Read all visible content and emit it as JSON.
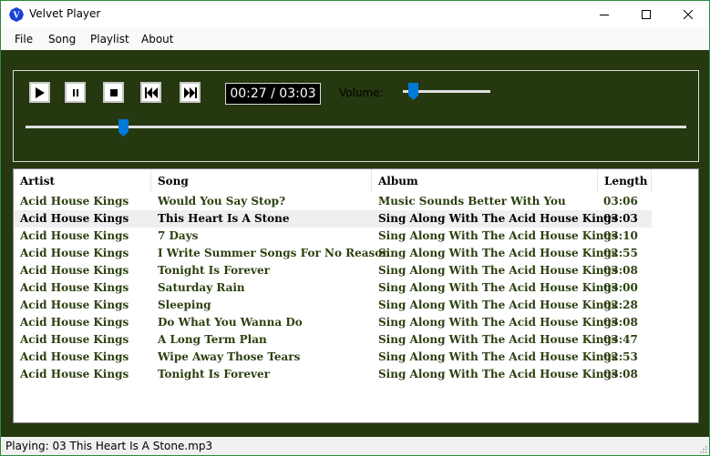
{
  "window": {
    "title": "Velvet Player",
    "icon": "velvet-logo-icon",
    "controls": [
      "minimize-icon",
      "maximize-icon",
      "close-icon"
    ]
  },
  "menu": {
    "items": [
      {
        "label": "File"
      },
      {
        "label": "Song"
      },
      {
        "label": "Playlist"
      },
      {
        "label": "About"
      }
    ]
  },
  "player": {
    "buttons": [
      {
        "name": "play",
        "icon": "play-icon"
      },
      {
        "name": "pause",
        "icon": "pause-icon"
      },
      {
        "name": "stop",
        "icon": "stop-icon"
      },
      {
        "name": "previous",
        "icon": "skip-back-icon"
      },
      {
        "name": "next",
        "icon": "skip-forward-icon"
      }
    ],
    "time_display": "00:27 / 03:03",
    "volume_label": "Volume:",
    "volume_level": 0.12,
    "seek_position": 0.148,
    "accent_color": "#0078d7"
  },
  "playlist": {
    "columns": [
      "Artist",
      "Song",
      "Album",
      "Length"
    ],
    "selected_index": 1,
    "rows": [
      {
        "artist": "Acid House Kings",
        "song": "Would You Say Stop?",
        "album": "Music Sounds Better With You",
        "length": "03:06"
      },
      {
        "artist": "Acid House Kings",
        "song": "This Heart Is A Stone",
        "album": "Sing Along With The Acid House Kings",
        "length": "03:03"
      },
      {
        "artist": "Acid House Kings",
        "song": "7 Days",
        "album": "Sing Along With The Acid House Kings",
        "length": "03:10"
      },
      {
        "artist": "Acid House Kings",
        "song": "I Write Summer Songs For No Reason",
        "album": "Sing Along With The Acid House Kings",
        "length": "02:55"
      },
      {
        "artist": "Acid House Kings",
        "song": "Tonight Is Forever",
        "album": "Sing Along With The Acid House Kings",
        "length": "03:08"
      },
      {
        "artist": "Acid House Kings",
        "song": "Saturday Rain",
        "album": "Sing Along With The Acid House Kings",
        "length": "03:00"
      },
      {
        "artist": "Acid House Kings",
        "song": "Sleeping",
        "album": "Sing Along With The Acid House Kings",
        "length": "02:28"
      },
      {
        "artist": "Acid House Kings",
        "song": "Do What You Wanna Do",
        "album": "Sing Along With The Acid House Kings",
        "length": "03:08"
      },
      {
        "artist": "Acid House Kings",
        "song": "A Long Term Plan",
        "album": "Sing Along With The Acid House Kings",
        "length": "03:47"
      },
      {
        "artist": "Acid House Kings",
        "song": "Wipe Away Those Tears",
        "album": "Sing Along With The Acid House Kings",
        "length": "02:53"
      },
      {
        "artist": "Acid House Kings",
        "song": "Tonight Is Forever",
        "album": "Sing Along With The Acid House Kings",
        "length": "03:08"
      }
    ]
  },
  "status": {
    "text": "Playing: 03 This Heart Is A Stone.mp3"
  }
}
